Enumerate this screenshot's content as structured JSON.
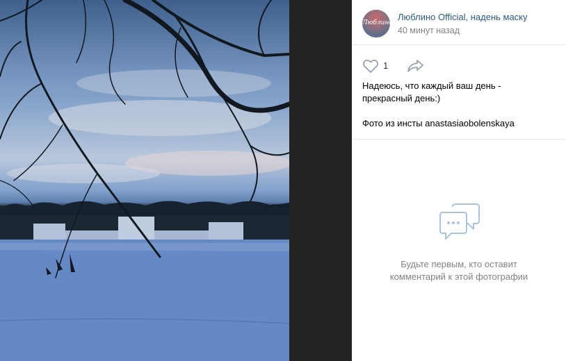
{
  "post": {
    "author": "Люблино Official, надень маску",
    "time": "40 минут назад",
    "avatar_text": "Люблино",
    "likes": "1",
    "caption_line1": "Надеюсь, что каждый ваш день -",
    "caption_line2": "прекрасный день:)",
    "caption_line3": "Фото из инсты anastasiaobolenskaya"
  },
  "comments": {
    "empty_line1": "Будьте первым, кто оставит",
    "empty_line2": "комментарий к этой фотографии"
  },
  "icons": {
    "like": "heart-outline-icon",
    "share": "share-arrow-icon",
    "comments_empty": "speech-bubbles-icon"
  },
  "colors": {
    "link": "#2a5885",
    "muted": "#828282",
    "icon": "#99a2ad",
    "empty_icon": "#a8c3e0",
    "viewer_bg": "#232323"
  }
}
